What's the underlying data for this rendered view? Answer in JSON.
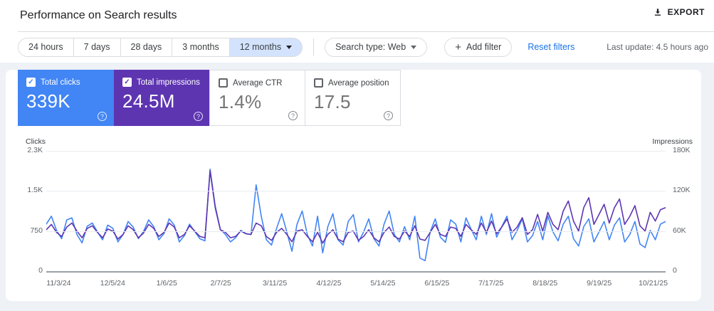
{
  "header": {
    "title": "Performance on Search results",
    "export_label": "EXPORT"
  },
  "filters": {
    "date_range": {
      "options": [
        "24 hours",
        "7 days",
        "28 days",
        "3 months",
        "12 months"
      ],
      "selected": "12 months",
      "selected_index": 4
    },
    "search_type_label": "Search type: Web",
    "add_filter_label": "Add filter",
    "reset_label": "Reset filters",
    "last_update": "Last update: 4.5 hours ago"
  },
  "metrics": [
    {
      "label": "Total clicks",
      "value": "339K",
      "checked": true,
      "color": "#4285f4"
    },
    {
      "label": "Total impressions",
      "value": "24.5M",
      "checked": true,
      "color": "#5e35b1"
    },
    {
      "label": "Average CTR",
      "value": "1.4%",
      "checked": false
    },
    {
      "label": "Average position",
      "value": "17.5",
      "checked": false
    }
  ],
  "chart_data": {
    "type": "line",
    "title": "Clicks and impressions over time (12 months, daily)",
    "grid": true,
    "legend_position": "none",
    "x_labels": [
      "11/3/24",
      "12/5/24",
      "1/6/25",
      "2/7/25",
      "3/11/25",
      "4/12/25",
      "5/14/25",
      "6/15/25",
      "7/17/25",
      "8/18/25",
      "9/19/25",
      "10/21/25"
    ],
    "axes": {
      "left": {
        "label": "Clicks",
        "ticks": [
          "2.3K",
          "1.5K",
          "750",
          "0"
        ],
        "range": [
          0,
          2300
        ]
      },
      "right": {
        "label": "Impressions",
        "ticks": [
          "180K",
          "120K",
          "60K",
          "0"
        ],
        "range": [
          0,
          180000
        ]
      }
    },
    "series": [
      {
        "name": "Total clicks",
        "axis": "left",
        "color": "#4285f4",
        "unit": "clicks",
        "scale_max": 2300,
        "values": [
          900,
          1050,
          780,
          620,
          980,
          1020,
          700,
          540,
          860,
          920,
          750,
          600,
          880,
          820,
          560,
          700,
          950,
          840,
          620,
          760,
          980,
          850,
          600,
          720,
          1000,
          880,
          560,
          680,
          900,
          760,
          620,
          580,
          1950,
          1250,
          800,
          700,
          560,
          640,
          780,
          720,
          700,
          1650,
          1050,
          600,
          500,
          820,
          1100,
          750,
          380,
          900,
          1150,
          700,
          480,
          1050,
          350,
          850,
          1100,
          600,
          500,
          950,
          1080,
          560,
          750,
          1000,
          620,
          480,
          900,
          1150,
          700,
          560,
          850,
          600,
          1050,
          250,
          200,
          750,
          1000,
          650,
          550,
          980,
          900,
          560,
          1020,
          800,
          600,
          1050,
          700,
          1100,
          650,
          850,
          1050,
          600,
          780,
          1000,
          560,
          680,
          950,
          600,
          1050,
          750,
          580,
          900,
          1050,
          620,
          480,
          850,
          1000,
          560,
          750,
          950,
          600,
          880,
          1020,
          560,
          700,
          950,
          520,
          450,
          780,
          600,
          900,
          950
        ]
      },
      {
        "name": "Total impressions",
        "axis": "right",
        "color": "#5e35b1",
        "unit": "thousands",
        "scale_max": 180,
        "values": [
          62,
          70,
          58,
          52,
          66,
          72,
          60,
          50,
          64,
          68,
          58,
          50,
          63,
          60,
          48,
          55,
          68,
          62,
          50,
          57,
          70,
          64,
          52,
          58,
          72,
          66,
          50,
          55,
          68,
          60,
          52,
          50,
          150,
          95,
          62,
          58,
          50,
          52,
          60,
          56,
          55,
          72,
          68,
          52,
          46,
          58,
          64,
          55,
          44,
          60,
          62,
          52,
          44,
          58,
          42,
          55,
          62,
          48,
          44,
          58,
          60,
          46,
          52,
          62,
          50,
          44,
          58,
          66,
          52,
          48,
          60,
          52,
          68,
          48,
          46,
          58,
          70,
          55,
          52,
          66,
          64,
          52,
          70,
          62,
          55,
          72,
          58,
          75,
          56,
          66,
          78,
          58,
          66,
          80,
          55,
          62,
          85,
          60,
          88,
          70,
          62,
          90,
          105,
          75,
          60,
          95,
          110,
          70,
          85,
          100,
          72,
          95,
          108,
          70,
          82,
          98,
          68,
          60,
          88,
          75,
          92,
          95
        ]
      }
    ]
  },
  "colors": {
    "clicks_blue": "#4285f4",
    "impressions_purple": "#5e35b1",
    "selected_range_bg": "#d3e3fd",
    "link_blue": "#1a73e8",
    "border_gray": "#dadce0",
    "page_bg": "#eef1f6",
    "text_primary": "#202124",
    "text_secondary": "#5f6368"
  }
}
